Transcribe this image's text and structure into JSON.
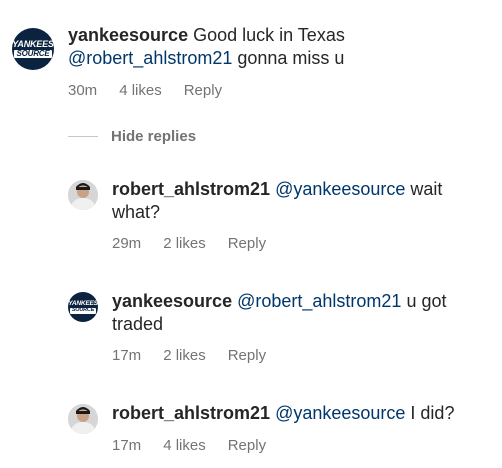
{
  "comments": [
    {
      "username": "yankeesource",
      "text_before": " Good luck in Texas",
      "mention": "@robert_ahlstrom21",
      "text_after": " gonna miss u",
      "time": "30m",
      "likes": "4 likes",
      "reply": "Reply",
      "avatar_line1": "YANKEES",
      "avatar_line2": "SOURCE"
    }
  ],
  "hide_replies": "Hide replies",
  "replies": [
    {
      "username": "robert_ahlstrom21",
      "mention": "@yankeesource",
      "text": " wait what?",
      "time": "29m",
      "likes": "2 likes",
      "reply": "Reply"
    },
    {
      "username": "yankeesource",
      "mention": "@robert_ahlstrom21",
      "text": " u got traded",
      "time": "17m",
      "likes": "2 likes",
      "reply": "Reply",
      "avatar_line1": "YANKEES",
      "avatar_line2": "SOURCE"
    },
    {
      "username": "robert_ahlstrom21",
      "mention": "@yankeesource",
      "text": " I did?",
      "time": "17m",
      "likes": "4 likes",
      "reply": "Reply"
    }
  ],
  "colors": {
    "mention": "#00376b",
    "meta": "#737373",
    "yankees_navy": "#0c2340"
  }
}
